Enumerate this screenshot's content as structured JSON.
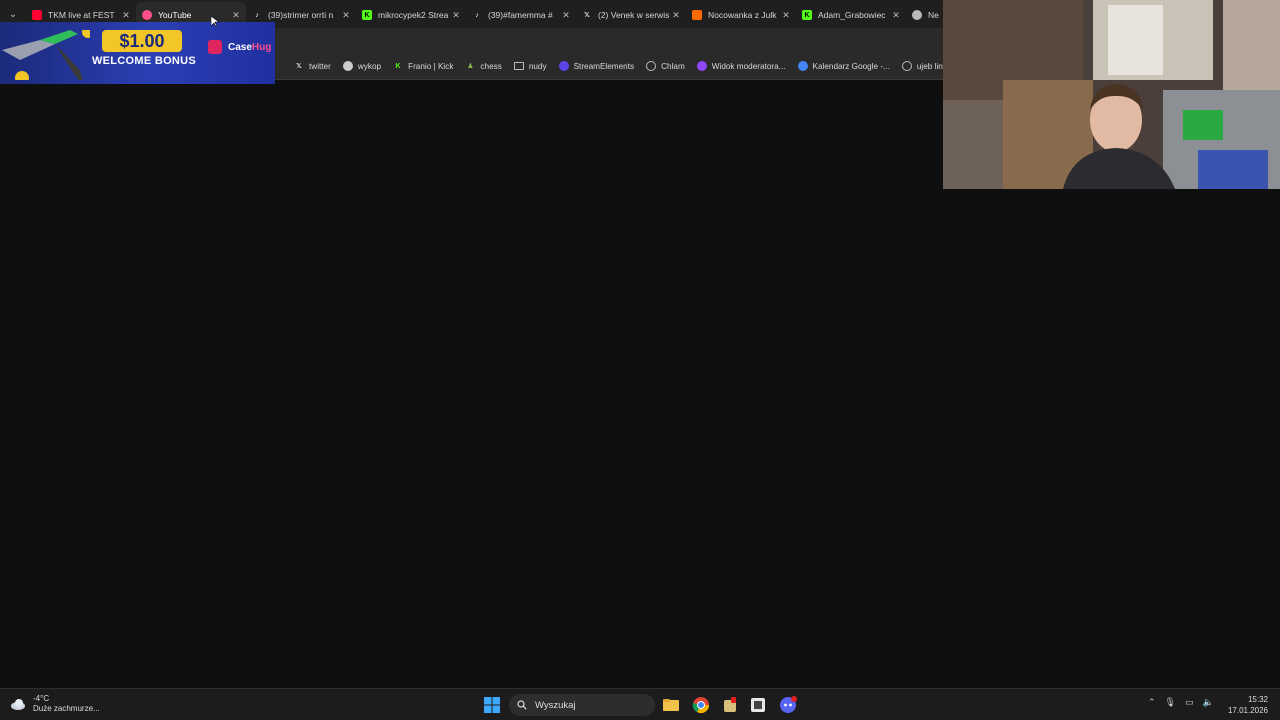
{
  "tabs": [
    {
      "title": "TKM live at FEST",
      "favicon": "youtube",
      "color": "#ff0033"
    },
    {
      "title": "YouTube",
      "favicon": "youtube-alt",
      "color": "#ff4f8b",
      "active": true
    },
    {
      "title": "(39)strimer orrti n",
      "favicon": "tiktok",
      "color": "#ffffff"
    },
    {
      "title": "mikrocypek2 Strea",
      "favicon": "kick",
      "color": "#53fc18"
    },
    {
      "title": "(39)#famemma #",
      "favicon": "tiktok",
      "color": "#ffffff"
    },
    {
      "title": "(2) Venek w serwis",
      "favicon": "x",
      "color": "#ffffff"
    },
    {
      "title": "Nocowanka z Julk",
      "favicon": "a",
      "color": "#ff6a00"
    },
    {
      "title": "Adam_Grabowiec",
      "favicon": "kick",
      "color": "#53fc18"
    },
    {
      "title": "Ne",
      "favicon": "globe",
      "color": "#bbbbbb"
    }
  ],
  "bookmarks": [
    {
      "label": "twitter",
      "icon": "x-icon"
    },
    {
      "label": "wykop",
      "icon": "wykop-icon"
    },
    {
      "label": "Franio | Kick",
      "icon": "kick-icon"
    },
    {
      "label": "chess",
      "icon": "chess-icon"
    },
    {
      "label": "nudy",
      "icon": "folder-icon"
    },
    {
      "label": "StreamElements",
      "icon": "streamelements-icon"
    },
    {
      "label": "Chlam",
      "icon": "globe-icon"
    },
    {
      "label": "Widok moderatora...",
      "icon": "twitch-icon"
    },
    {
      "label": "Kalendarz Google -...",
      "icon": "calendar-icon"
    },
    {
      "label": "ujeb link",
      "icon": "globe-icon"
    }
  ],
  "ad": {
    "amount": "$1.00",
    "text": "WELCOME BONUS",
    "brand_a": "Case",
    "brand_b": "Hug"
  },
  "taskbar": {
    "weather_temp": "-4°C",
    "weather_desc": "Duże zachmurze...",
    "search_placeholder": "Wyszukaj",
    "time": "15:32",
    "date": "17.01.2026"
  }
}
